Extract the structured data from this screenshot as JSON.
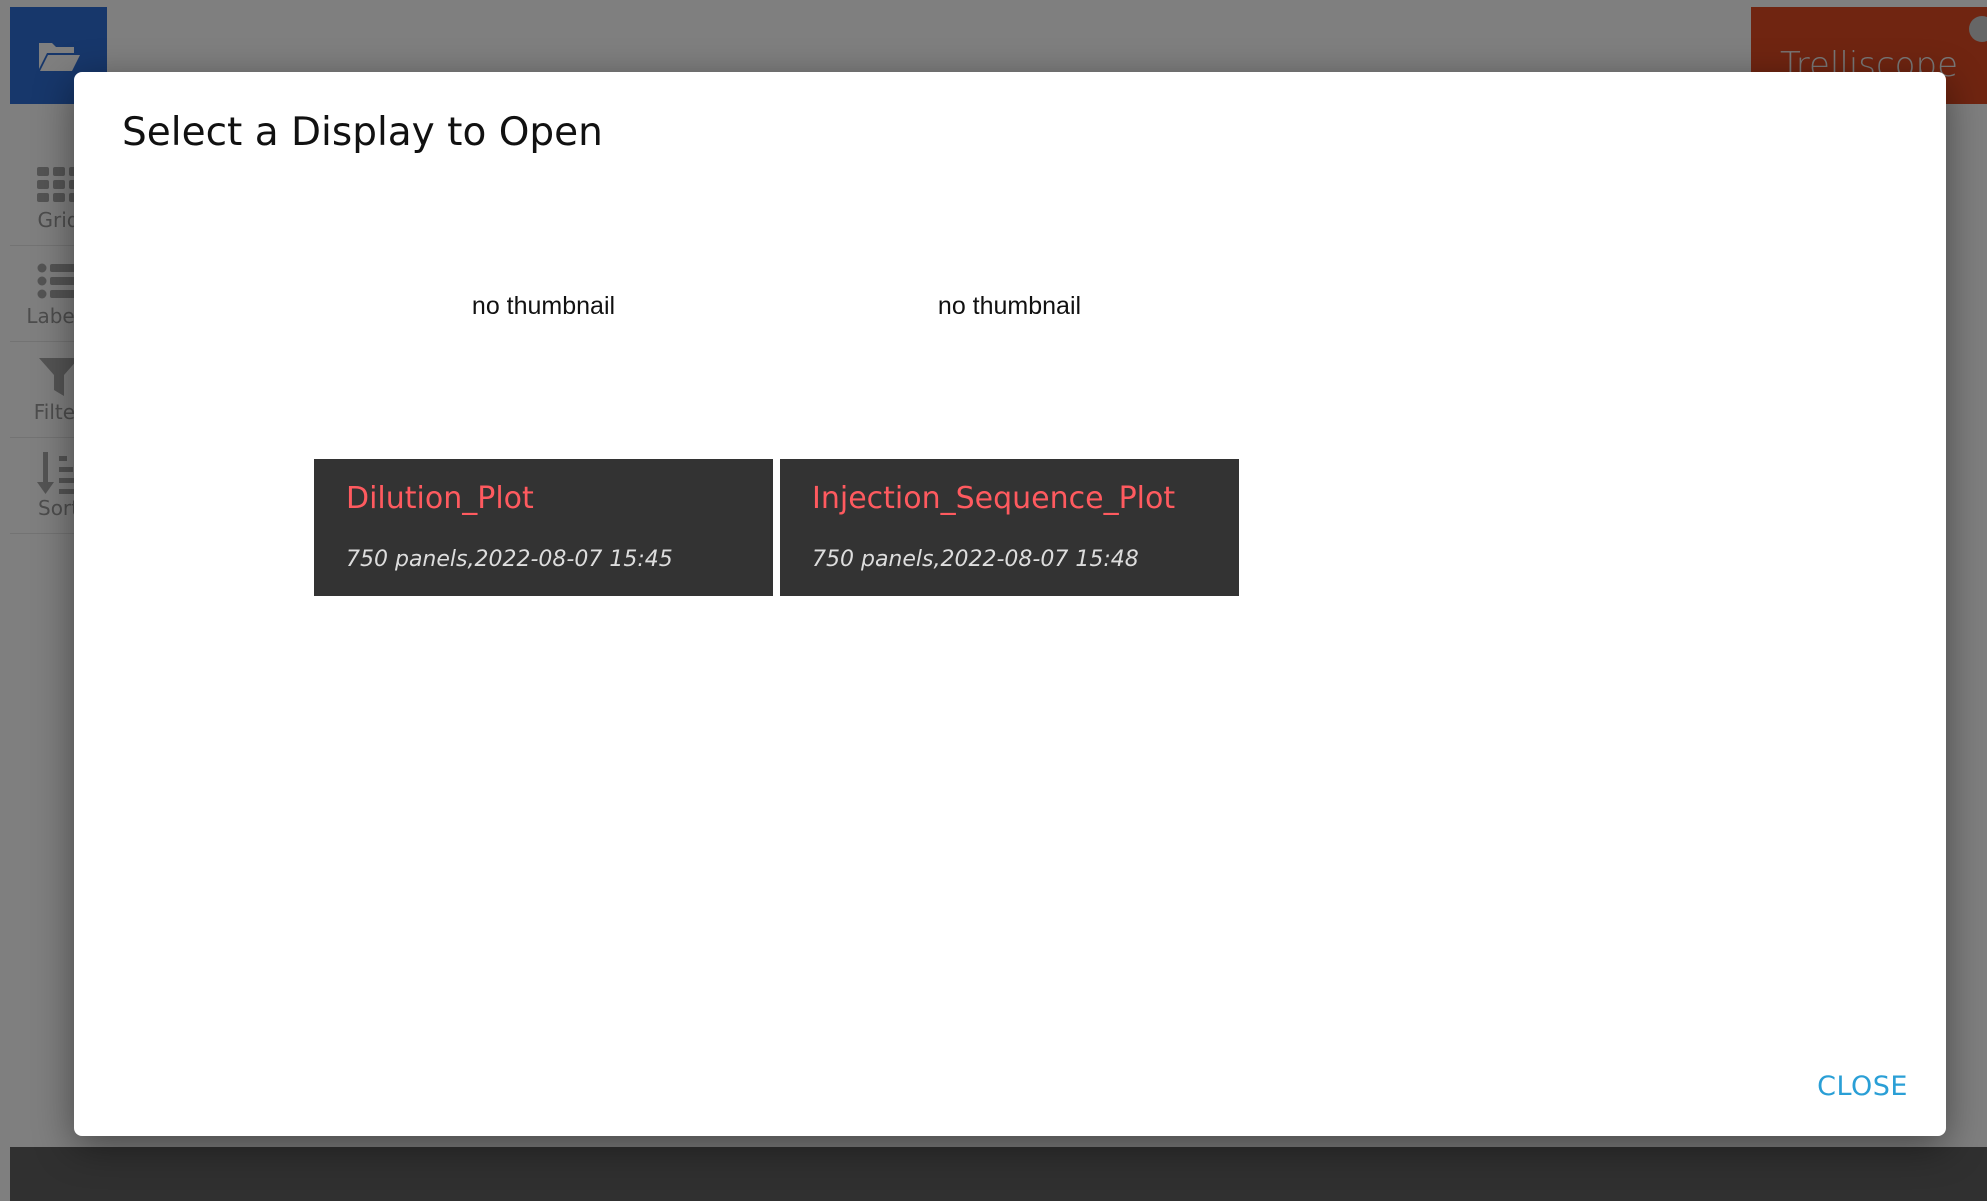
{
  "app": {
    "brand": "Trelliscope",
    "open_icon": "folder-open-icon",
    "sidebar": [
      {
        "label": "Grid",
        "icon": "grid-icon"
      },
      {
        "label": "Labels",
        "icon": "list-icon"
      },
      {
        "label": "Filter",
        "icon": "filter-icon"
      },
      {
        "label": "Sort",
        "icon": "sort-icon"
      }
    ]
  },
  "dialog": {
    "title": "Select a Display to Open",
    "close_label": "CLOSE",
    "displays": [
      {
        "name": "Dilution_Plot",
        "thumbnail_text": "no thumbnail",
        "meta": "750 panels,2022-08-07 15:45"
      },
      {
        "name": "Injection_Sequence_Plot",
        "thumbnail_text": "no thumbnail",
        "meta": "750 panels,2022-08-07 15:48"
      }
    ]
  },
  "colors": {
    "open_button": "#2f6fd6",
    "brand_bg": "#e04b23",
    "display_name": "#ff5a5f",
    "card_info_bg": "#333333",
    "close_link": "#2a9fd6"
  }
}
